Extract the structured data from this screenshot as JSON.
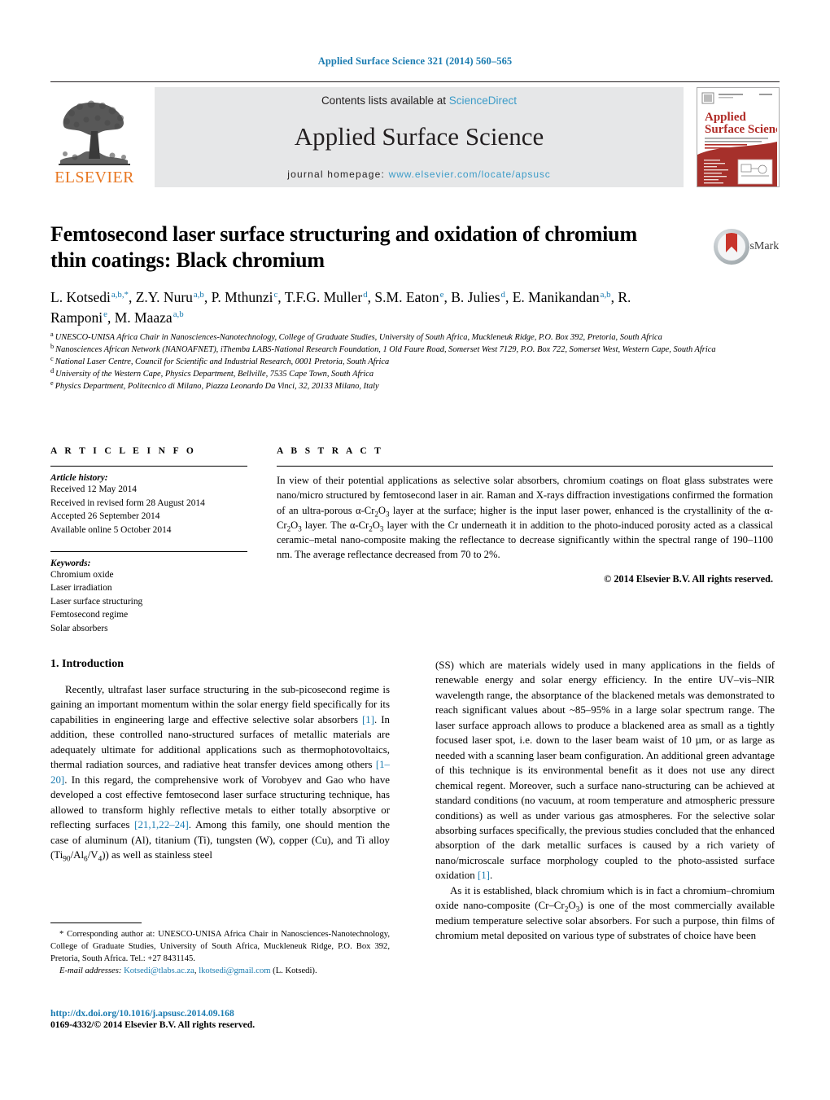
{
  "running_head": "Applied Surface Science 321 (2014) 560–565",
  "masthead": {
    "publisher_name": "ELSEVIER",
    "contents_prefix": "Contents lists available at ",
    "contents_link": "ScienceDirect",
    "journal_title": "Applied Surface Science",
    "homepage_prefix": "journal homepage: ",
    "homepage_url": "www.elsevier.com/locate/apsusc",
    "cover": {
      "line1": "Applied",
      "line2": "Surface Science"
    }
  },
  "article": {
    "title": "Femtosecond laser surface structuring and oxidation of chromium thin coatings: Black chromium",
    "crossmark_label": "CrossMark",
    "authors": [
      {
        "name": "L. Kotsedi",
        "sup": "a,b,*"
      },
      {
        "name": "Z.Y. Nuru",
        "sup": "a,b"
      },
      {
        "name": "P. Mthunzi",
        "sup": "c"
      },
      {
        "name": "T.F.G. Muller",
        "sup": "d"
      },
      {
        "name": "S.M. Eaton",
        "sup": "e"
      },
      {
        "name": "B. Julies",
        "sup": "d"
      },
      {
        "name": "E. Manikandan",
        "sup": "a,b"
      },
      {
        "name": "R. Ramponi",
        "sup": "e"
      },
      {
        "name": "M. Maaza",
        "sup": "a,b"
      }
    ],
    "affiliations": [
      {
        "marker": "a",
        "text": "UNESCO-UNISA Africa Chair in Nanosciences-Nanotechnology, College of Graduate Studies, University of South Africa, Muckleneuk Ridge, P.O. Box 392, Pretoria, South Africa"
      },
      {
        "marker": "b",
        "text": "Nanosciences African Network (NANOAFNET), iThemba LABS-National Research Foundation, 1 Old Faure Road, Somerset West 7129, P.O. Box 722, Somerset West, Western Cape, South Africa"
      },
      {
        "marker": "c",
        "text": "National Laser Centre, Council for Scientific and Industrial Research, 0001 Pretoria, South Africa"
      },
      {
        "marker": "d",
        "text": "University of the Western Cape, Physics Department, Bellville, 7535 Cape Town, South Africa"
      },
      {
        "marker": "e",
        "text": "Physics Department, Politecnico di Milano, Piazza Leonardo Da Vinci, 32, 20133 Milano, Italy"
      }
    ]
  },
  "article_info": {
    "heading": "A R T I C L E   I N F O",
    "history_title": "Article history:",
    "history": [
      "Received 12 May 2014",
      "Received in revised form 28 August 2014",
      "Accepted 26 September 2014",
      "Available online 5 October 2014"
    ],
    "keywords_title": "Keywords:",
    "keywords": [
      "Chromium oxide",
      "Laser irradiation",
      "Laser surface structuring",
      "Femtosecond regime",
      "Solar absorbers"
    ]
  },
  "abstract": {
    "heading": "A B S T R A C T",
    "copyright": "© 2014 Elsevier B.V. All rights reserved."
  },
  "introduction": {
    "heading": "1.  Introduction"
  },
  "footnote": {
    "corresponding": "* Corresponding author at: UNESCO-UNISA Africa Chair in Nanosciences-Nanotechnology, College of Graduate Studies, University of South Africa, Muckleneuk Ridge, P.O. Box 392, Pretoria, South Africa. Tel.: +27 8431145.",
    "email_label": "E-mail addresses:",
    "email1": "Kotsedi@tlabs.ac.za",
    "email2": "lkotsedi@gmail.com",
    "email_suffix": "(L. Kotsedi)."
  },
  "doi": {
    "url": "http://dx.doi.org/10.1016/j.apsusc.2014.09.168",
    "issn": "0169-4332/© 2014 Elsevier B.V. All rights reserved."
  },
  "colors": {
    "link": "#3d9cc8",
    "reference": "#1a7bb0",
    "elsevier_orange": "#e87722",
    "banner_gray": "#e6e7e8"
  }
}
